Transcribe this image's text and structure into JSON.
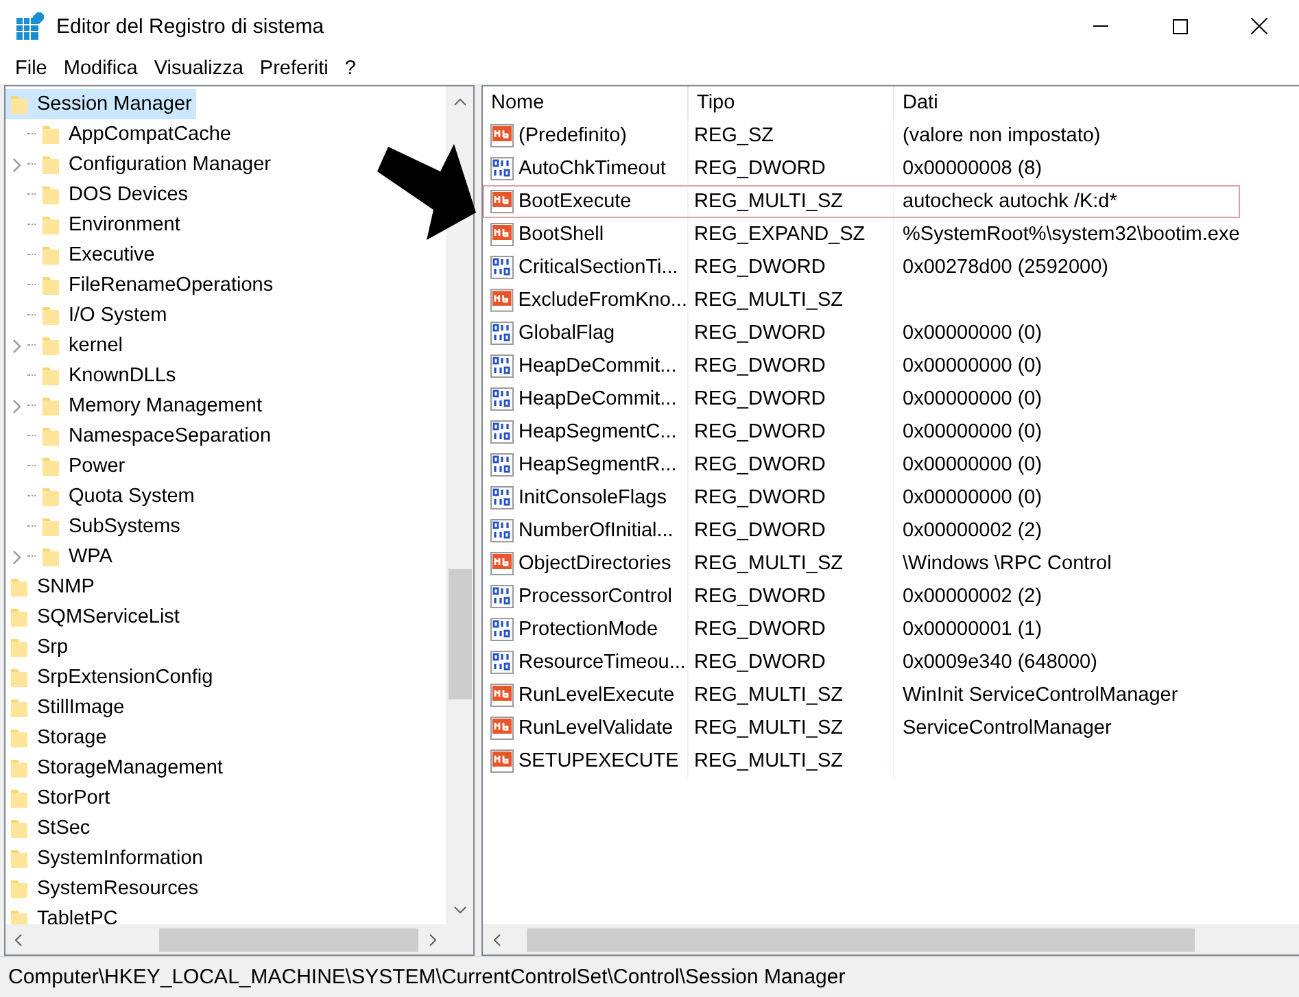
{
  "window": {
    "title": "Editor del Registro di sistema"
  },
  "menu": [
    {
      "label": "File"
    },
    {
      "label": "Modifica"
    },
    {
      "label": "Visualizza"
    },
    {
      "label": "Preferiti"
    },
    {
      "label": "?"
    }
  ],
  "tree": {
    "items": [
      {
        "label": "Session Manager",
        "selected": true,
        "children": [
          {
            "label": "AppCompatCache",
            "selected": false,
            "expandable": false
          },
          {
            "label": "Configuration Manager",
            "selected": false,
            "expandable": true
          },
          {
            "label": "DOS Devices",
            "selected": false,
            "expandable": false
          },
          {
            "label": "Environment",
            "selected": false,
            "expandable": false
          },
          {
            "label": "Executive",
            "selected": false,
            "expandable": false
          },
          {
            "label": "FileRenameOperations",
            "selected": false,
            "expandable": false
          },
          {
            "label": "I/O System",
            "selected": false,
            "expandable": false
          },
          {
            "label": "kernel",
            "selected": false,
            "expandable": true
          },
          {
            "label": "KnownDLLs",
            "selected": false,
            "expandable": false
          },
          {
            "label": "Memory Management",
            "selected": false,
            "expandable": true
          },
          {
            "label": "NamespaceSeparation",
            "selected": false,
            "expandable": false
          },
          {
            "label": "Power",
            "selected": false,
            "expandable": false
          },
          {
            "label": "Quota System",
            "selected": false,
            "expandable": false
          },
          {
            "label": "SubSystems",
            "selected": false,
            "expandable": false
          },
          {
            "label": "WPA",
            "selected": false,
            "expandable": true
          }
        ]
      },
      {
        "label": "SNMP",
        "selected": false
      },
      {
        "label": "SQMServiceList",
        "selected": false
      },
      {
        "label": "Srp",
        "selected": false
      },
      {
        "label": "SrpExtensionConfig",
        "selected": false
      },
      {
        "label": "StillImage",
        "selected": false
      },
      {
        "label": "Storage",
        "selected": false
      },
      {
        "label": "StorageManagement",
        "selected": false
      },
      {
        "label": "StorPort",
        "selected": false
      },
      {
        "label": "StSec",
        "selected": false
      },
      {
        "label": "SystemInformation",
        "selected": false
      },
      {
        "label": "SystemResources",
        "selected": false
      },
      {
        "label": "TabletPC",
        "selected": false
      }
    ]
  },
  "values": {
    "columns": [
      "Nome",
      "Tipo",
      "Dati"
    ],
    "rows": [
      {
        "name": "(Predefinito)",
        "type": "REG_SZ",
        "data": "(valore non impostato)",
        "kind": "string",
        "highlighted": false
      },
      {
        "name": "AutoChkTimeout",
        "type": "REG_DWORD",
        "data": "0x00000008 (8)",
        "kind": "dword",
        "highlighted": false
      },
      {
        "name": "BootExecute",
        "type": "REG_MULTI_SZ",
        "data": "autocheck autochk /K:d*",
        "kind": "string",
        "highlighted": true
      },
      {
        "name": "BootShell",
        "type": "REG_EXPAND_SZ",
        "data": "%SystemRoot%\\system32\\bootim.exe",
        "kind": "string",
        "highlighted": false
      },
      {
        "name": "CriticalSectionTi...",
        "type": "REG_DWORD",
        "data": "0x00278d00 (2592000)",
        "kind": "dword",
        "highlighted": false
      },
      {
        "name": "ExcludeFromKno...",
        "type": "REG_MULTI_SZ",
        "kind": "string",
        "highlighted": false
      },
      {
        "name": "GlobalFlag",
        "type": "REG_DWORD",
        "data": "0x00000000 (0)",
        "kind": "dword",
        "highlighted": false
      },
      {
        "name": "HeapDeCommit...",
        "type": "REG_DWORD",
        "data": "0x00000000 (0)",
        "kind": "dword",
        "highlighted": false
      },
      {
        "name": "HeapDeCommit...",
        "type": "REG_DWORD",
        "data": "0x00000000 (0)",
        "kind": "dword",
        "highlighted": false
      },
      {
        "name": "HeapSegmentC...",
        "type": "REG_DWORD",
        "data": "0x00000000 (0)",
        "kind": "dword",
        "highlighted": false
      },
      {
        "name": "HeapSegmentR...",
        "type": "REG_DWORD",
        "data": "0x00000000 (0)",
        "kind": "dword",
        "highlighted": false
      },
      {
        "name": "InitConsoleFlags",
        "type": "REG_DWORD",
        "data": "0x00000000 (0)",
        "kind": "dword",
        "highlighted": false
      },
      {
        "name": "NumberOfInitial...",
        "type": "REG_DWORD",
        "data": "0x00000002 (2)",
        "kind": "dword",
        "highlighted": false
      },
      {
        "name": "ObjectDirectories",
        "type": "REG_MULTI_SZ",
        "data": "\\Windows \\RPC Control",
        "kind": "string",
        "highlighted": false
      },
      {
        "name": "ProcessorControl",
        "type": "REG_DWORD",
        "data": "0x00000002 (2)",
        "kind": "dword",
        "highlighted": false
      },
      {
        "name": "ProtectionMode",
        "type": "REG_DWORD",
        "data": "0x00000001 (1)",
        "kind": "dword",
        "highlighted": false
      },
      {
        "name": "ResourceTimeou...",
        "type": "REG_DWORD",
        "data": "0x0009e340 (648000)",
        "kind": "dword",
        "highlighted": false
      },
      {
        "name": "RunLevelExecute",
        "type": "REG_MULTI_SZ",
        "data": "WinInit ServiceControlManager",
        "kind": "string",
        "highlighted": false
      },
      {
        "name": "RunLevelValidate",
        "type": "REG_MULTI_SZ",
        "data": "ServiceControlManager",
        "kind": "string",
        "highlighted": false
      },
      {
        "name": "SETUPEXECUTE",
        "type": "REG_MULTI_SZ",
        "kind": "string",
        "highlighted": false
      }
    ]
  },
  "status_bar": "Computer\\HKEY_LOCAL_MACHINE\\SYSTEM\\CurrentControlSet\\Control\\Session Manager"
}
